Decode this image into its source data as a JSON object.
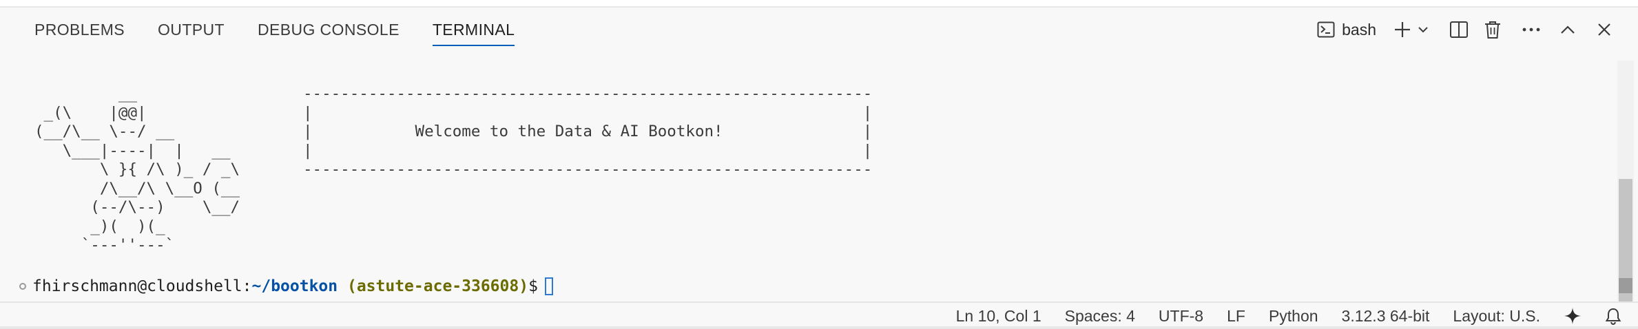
{
  "tabs": [
    {
      "label": "PROBLEMS"
    },
    {
      "label": "OUTPUT"
    },
    {
      "label": "DEBUG CONSOLE"
    },
    {
      "label": "TERMINAL"
    }
  ],
  "active_tab": "TERMINAL",
  "toolbar": {
    "shell_label": "bash",
    "icons": [
      "terminal-icon",
      "plus-icon",
      "chevron-down-icon",
      "split-icon",
      "trash-icon",
      "ellipsis-icon",
      "chevron-up-icon",
      "close-icon"
    ]
  },
  "terminal": {
    "art_lines": [
      "         __",
      " _(\\    |@@|",
      "(__/\\__ \\--/ __",
      "   \\___|----|  |   __",
      "       \\ }{ /\\ )_ / _\\",
      "       /\\__/\\ \\__O (__",
      "      (--/\\--)    \\__/",
      "      _)(  )(_",
      "     `---''---`"
    ],
    "banner_lines": [
      "-------------------------------------------------------------",
      "|                                                           |",
      "|           Welcome to the Data & AI Bootkon!               |",
      "|                                                           |",
      "-------------------------------------------------------------"
    ],
    "prompt": {
      "user_host": "fhirschmann@cloudshell:",
      "path": "~/bootkon",
      "project": " (astute-ace-336608)",
      "dollar": "$"
    }
  },
  "status_bar": {
    "position": "Ln 10, Col 1",
    "spaces": "Spaces: 4",
    "encoding": "UTF-8",
    "eol": "LF",
    "language": "Python",
    "interpreter": "3.12.3 64-bit",
    "layout": "Layout: U.S.",
    "icons": [
      "sparkle-icon",
      "bell-icon"
    ]
  },
  "colors": {
    "active_tab_underline": "#005fb8",
    "path": "#0451a5",
    "project": "#6b6b00",
    "cursor": "#2d79d6"
  }
}
